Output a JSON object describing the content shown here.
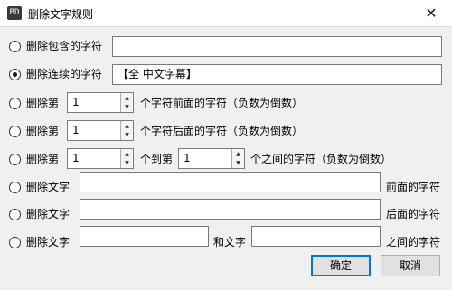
{
  "window": {
    "title": "删除文字规则",
    "icon_text": "BD",
    "close_glyph": "✕"
  },
  "options": {
    "contains": {
      "label": "删除包含的字符",
      "value": ""
    },
    "consecutive": {
      "label": "删除连续的字符",
      "value": "【全 中文字幕】",
      "selected": true
    },
    "before_n": {
      "prefix": "删除第",
      "value": "1",
      "suffix": "个字符前面的字符（负数为倒数）"
    },
    "after_n": {
      "prefix": "删除第",
      "value": "1",
      "suffix": "个字符后面的字符（负数为倒数）"
    },
    "range": {
      "prefix": "删除第",
      "from": "1",
      "mid": "个到第",
      "to": "1",
      "suffix": "个之间的字符（负数为倒数）"
    },
    "before_text": {
      "prefix": "删除文字",
      "value": "",
      "suffix": "前面的字符"
    },
    "after_text": {
      "prefix": "删除文字",
      "value": "",
      "suffix": "后面的字符"
    },
    "between_text": {
      "prefix": "删除文字",
      "value1": "",
      "mid": "和文字",
      "value2": "",
      "suffix": "之间的字符"
    }
  },
  "spinner": {
    "up_glyph": "▲",
    "down_glyph": "▼"
  },
  "buttons": {
    "ok": "确定",
    "cancel": "取消"
  }
}
